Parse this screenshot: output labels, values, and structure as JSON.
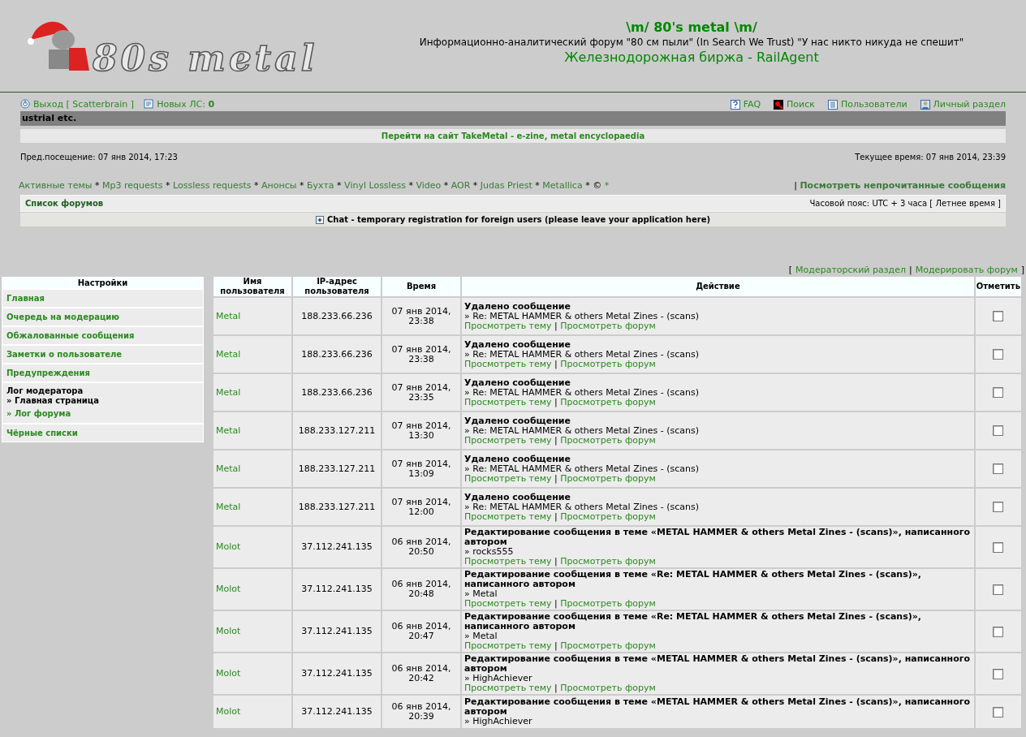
{
  "header": {
    "logo_text": "80s metal",
    "title": "\\m/ 80's metal \\m/",
    "tagline": "Информационно-аналитический форум \"80 см пыли\" (In Search We Trust) \"У нас никто никуда не спешит\"",
    "promo_link": "Железнодорожная биржа - RailAgent"
  },
  "user_bar": {
    "logout": "Выход [ Scatterbrain ]",
    "pm_label": "Новых ЛС:",
    "pm_count": "0",
    "right_links": [
      "FAQ",
      "Поиск",
      "Пользователи",
      "Личный раздел"
    ]
  },
  "ticker": "ustrial etc.",
  "banner_link": "Перейти на сайт TakeMetal - e-zine, metal encyclopaedia",
  "last_visit": "Пред.посещение: 07 янв 2014, 17:23",
  "current_time": "Текущее время: 07 янв 2014, 23:39",
  "nav_links": [
    {
      "label": "Активные темы",
      "kind": "link"
    },
    {
      "label": "*",
      "kind": "separator"
    },
    {
      "label": "Mp3 requests",
      "kind": "link"
    },
    {
      "label": "*",
      "kind": "separator"
    },
    {
      "label": "Lossless requests",
      "kind": "link"
    },
    {
      "label": "*",
      "kind": "separator"
    },
    {
      "label": "Анонсы",
      "kind": "link"
    },
    {
      "label": "*",
      "kind": "separator"
    },
    {
      "label": "Бухта",
      "kind": "link"
    },
    {
      "label": "*",
      "kind": "separator"
    },
    {
      "label": "Vinyl Lossless",
      "kind": "link"
    },
    {
      "label": "*",
      "kind": "separator"
    },
    {
      "label": "Video",
      "kind": "link"
    },
    {
      "label": "*",
      "kind": "separator"
    },
    {
      "label": "AOR",
      "kind": "link"
    },
    {
      "label": "*",
      "kind": "separator"
    },
    {
      "label": "Judas Priest",
      "kind": "link"
    },
    {
      "label": "*",
      "kind": "separator"
    },
    {
      "label": "Metallica",
      "kind": "link"
    },
    {
      "label": "*",
      "kind": "separator"
    },
    {
      "label": "©",
      "kind": "separator"
    },
    {
      "label": "*",
      "kind": "link"
    }
  ],
  "unread_sep": "|",
  "unread_link": "Посмотреть непрочитанные сообщения",
  "breadcrumb": "Список форумов",
  "timezone": "Часовой пояс: UTC + 3 часа [ Летнее время ]",
  "chat_link": "Chat - temporary registration for foreign users (please leave your application here)",
  "mod_links": {
    "open": "[",
    "items": [
      "Модераторский раздел",
      "Модерировать форум"
    ],
    "sep": "|",
    "close": "]"
  },
  "sidebar": {
    "title": "Настройки",
    "items": [
      {
        "label": "Главная",
        "kind": "link"
      },
      {
        "label": "Очередь на модерацию",
        "kind": "link"
      },
      {
        "label": "Обжалованные сообщения",
        "kind": "link"
      },
      {
        "label": "Заметки о пользователе",
        "kind": "link"
      },
      {
        "label": "Предупреждения",
        "kind": "link"
      },
      {
        "label": "Лог модератора",
        "kind": "group",
        "children": [
          {
            "label": "Главная страница",
            "marker": "»",
            "selected": true
          },
          {
            "label": "Лог форума",
            "marker": "»",
            "selected": false
          }
        ]
      },
      {
        "label": "Чёрные списки",
        "kind": "link"
      }
    ]
  },
  "log_table": {
    "columns": [
      "Имя пользователя",
      "IP-адрес пользователя",
      "Время",
      "Действие",
      "Отметить"
    ],
    "rows": [
      {
        "user": "Metal",
        "ip": "188.233.66.236",
        "time": "07 янв 2014, 23:38",
        "action": "Удалено сообщение",
        "subject": "» Re: METAL HAMMER & others Metal Zines - (scans)",
        "links": [
          "Просмотреть тему",
          "|",
          "Просмотреть форум"
        ],
        "checked": false
      },
      {
        "user": "Metal",
        "ip": "188.233.66.236",
        "time": "07 янв 2014, 23:38",
        "action": "Удалено сообщение",
        "subject": "» Re: METAL HAMMER & others Metal Zines - (scans)",
        "links": [
          "Просмотреть тему",
          "|",
          "Просмотреть форум"
        ],
        "checked": false
      },
      {
        "user": "Metal",
        "ip": "188.233.66.236",
        "time": "07 янв 2014, 23:35",
        "action": "Удалено сообщение",
        "subject": "» Re: METAL HAMMER & others Metal Zines - (scans)",
        "links": [
          "Просмотреть тему",
          "|",
          "Просмотреть форум"
        ],
        "checked": false
      },
      {
        "user": "Metal",
        "ip": "188.233.127.211",
        "time": "07 янв 2014, 13:30",
        "action": "Удалено сообщение",
        "subject": "» Re: METAL HAMMER & others Metal Zines - (scans)",
        "links": [
          "Просмотреть тему",
          "|",
          "Просмотреть форум"
        ],
        "checked": false
      },
      {
        "user": "Metal",
        "ip": "188.233.127.211",
        "time": "07 янв 2014, 13:09",
        "action": "Удалено сообщение",
        "subject": "» Re: METAL HAMMER & others Metal Zines - (scans)",
        "links": [
          "Просмотреть тему",
          "|",
          "Просмотреть форум"
        ],
        "checked": false
      },
      {
        "user": "Metal",
        "ip": "188.233.127.211",
        "time": "07 янв 2014, 12:00",
        "action": "Удалено сообщение",
        "subject": "» Re: METAL HAMMER & others Metal Zines - (scans)",
        "links": [
          "Просмотреть тему",
          "|",
          "Просмотреть форум"
        ],
        "checked": false
      },
      {
        "user": "Molot",
        "ip": "37.112.241.135",
        "time": "06 янв 2014, 20:50",
        "action": "Редактирование сообщения в теме «METAL HAMMER & others Metal Zines - (scans)», написанного автором",
        "subject": "» rocks555",
        "links": [
          "Просмотреть тему",
          "|",
          "Просмотреть форум"
        ],
        "checked": false
      },
      {
        "user": "Molot",
        "ip": "37.112.241.135",
        "time": "06 янв 2014, 20:48",
        "action": "Редактирование сообщения в теме «Re: METAL HAMMER & others Metal Zines - (scans)», написанного автором",
        "subject": "» Metal",
        "links": [
          "Просмотреть тему",
          "|",
          "Просмотреть форум"
        ],
        "checked": false
      },
      {
        "user": "Molot",
        "ip": "37.112.241.135",
        "time": "06 янв 2014, 20:47",
        "action": "Редактирование сообщения в теме «Re: METAL HAMMER & others Metal Zines - (scans)», написанного автором",
        "subject": "» Metal",
        "links": [
          "Просмотреть тему",
          "|",
          "Просмотреть форум"
        ],
        "checked": false
      },
      {
        "user": "Molot",
        "ip": "37.112.241.135",
        "time": "06 янв 2014, 20:42",
        "action": "Редактирование сообщения в теме «METAL HAMMER & others Metal Zines - (scans)», написанного автором",
        "subject": "» HighAchiever",
        "links": [
          "Просмотреть тему",
          "|",
          "Просмотреть форум"
        ],
        "checked": false
      },
      {
        "user": "Molot",
        "ip": "37.112.241.135",
        "time": "06 янв 2014, 20:39",
        "action": "Редактирование сообщения в теме «METAL HAMMER & others Metal Zines - (scans)», написанного автором",
        "subject": "» HighAchiever",
        "checked": false
      }
    ]
  }
}
